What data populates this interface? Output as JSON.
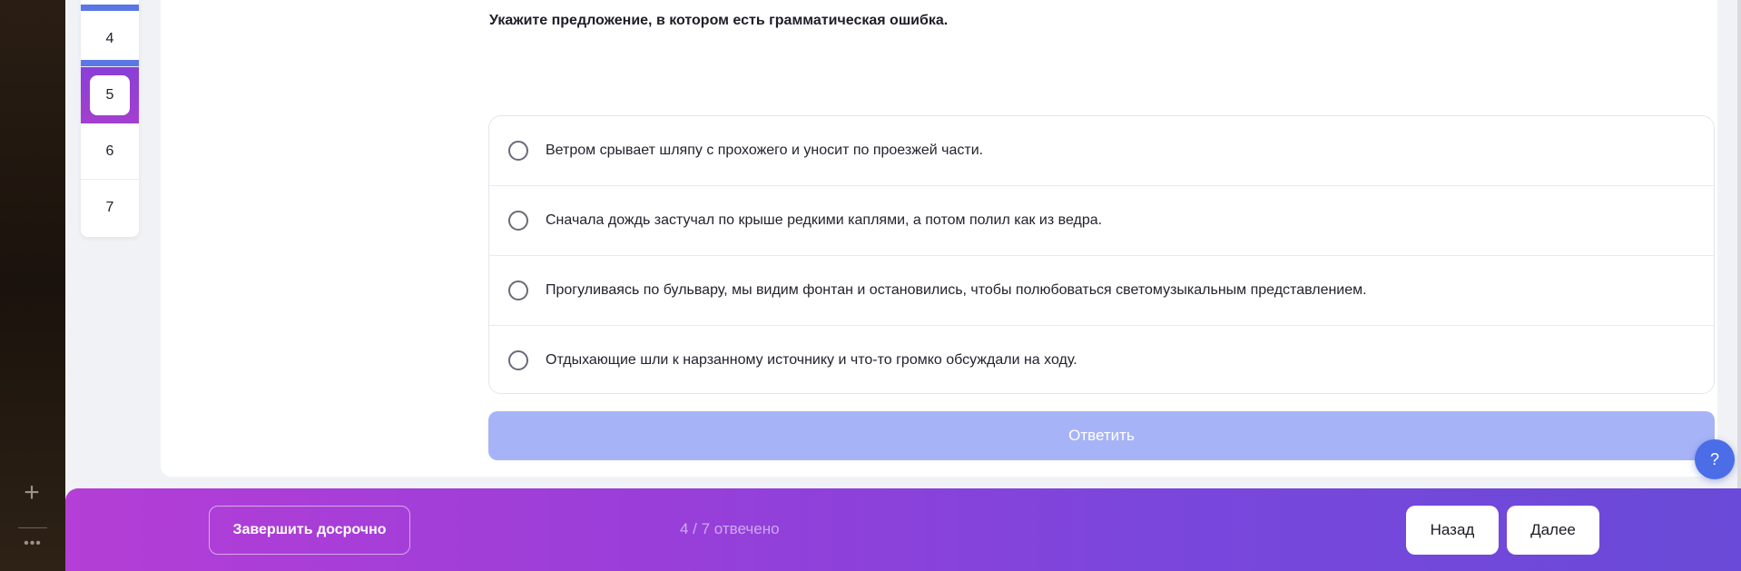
{
  "sidebar": {
    "question_numbers": [
      {
        "label": "4",
        "status": "answered"
      },
      {
        "label": "5",
        "status": "current"
      },
      {
        "label": "6",
        "status": "unanswered"
      },
      {
        "label": "7",
        "status": "unanswered"
      }
    ],
    "plus_icon": "+",
    "more_icon": "•••"
  },
  "question": {
    "text": "Укажите предложение, в котором есть грамматическая ошибка.",
    "options": [
      "Ветром срывает шляпу с прохожего и уносит по проезжей части.",
      "Сначала дождь застучал по крыше редкими каплями, а потом полил как из ведра.",
      "Прогуливаясь по бульвару, мы видим фонтан и остановились, чтобы полюбоваться светомузыкальным представлением.",
      "Отдыхающие шли к нарзанному источнику и что-то громко обсуждали на ходу."
    ],
    "answer_label": "Ответить"
  },
  "help": {
    "label": "?"
  },
  "footer": {
    "finish_label": "Завершить досрочно",
    "progress": "4 / 7 отвечено",
    "back_label": "Назад",
    "next_label": "Далее"
  },
  "colors": {
    "accent": "#5b77e6",
    "answer_button_disabled": "#a6b4f7",
    "footer_gradient_start": "#b43ed6",
    "footer_gradient_end": "#6a4ad8",
    "active_question": "#9a3fd4"
  }
}
